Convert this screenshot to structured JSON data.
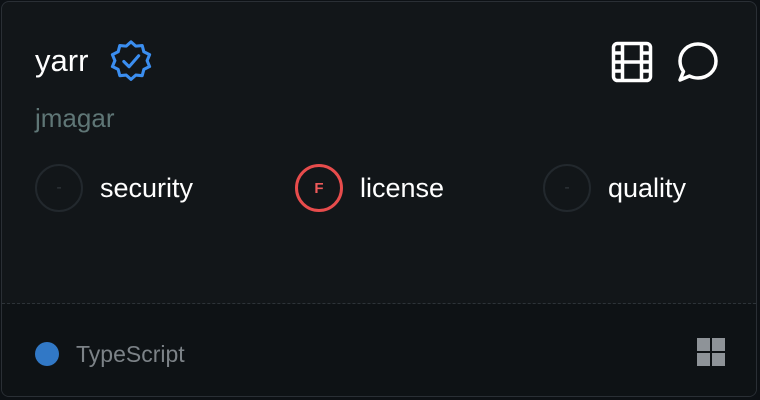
{
  "repo": {
    "name": "yarr",
    "owner": "jmagar",
    "verified_icon": "verified-badge-icon",
    "badge_color": "#3b8ef0"
  },
  "actions": [
    {
      "icon": "film-icon"
    },
    {
      "icon": "chat-bubble-icon"
    }
  ],
  "metrics": [
    {
      "label": "security",
      "grade": "-",
      "status": "empty"
    },
    {
      "label": "license",
      "grade": "F",
      "status": "fail",
      "color": "#e74c4c"
    },
    {
      "label": "quality",
      "grade": "-",
      "status": "empty"
    }
  ],
  "footer": {
    "language": "TypeScript",
    "language_color": "#3178c6",
    "grid_icon": "grid-icon"
  }
}
